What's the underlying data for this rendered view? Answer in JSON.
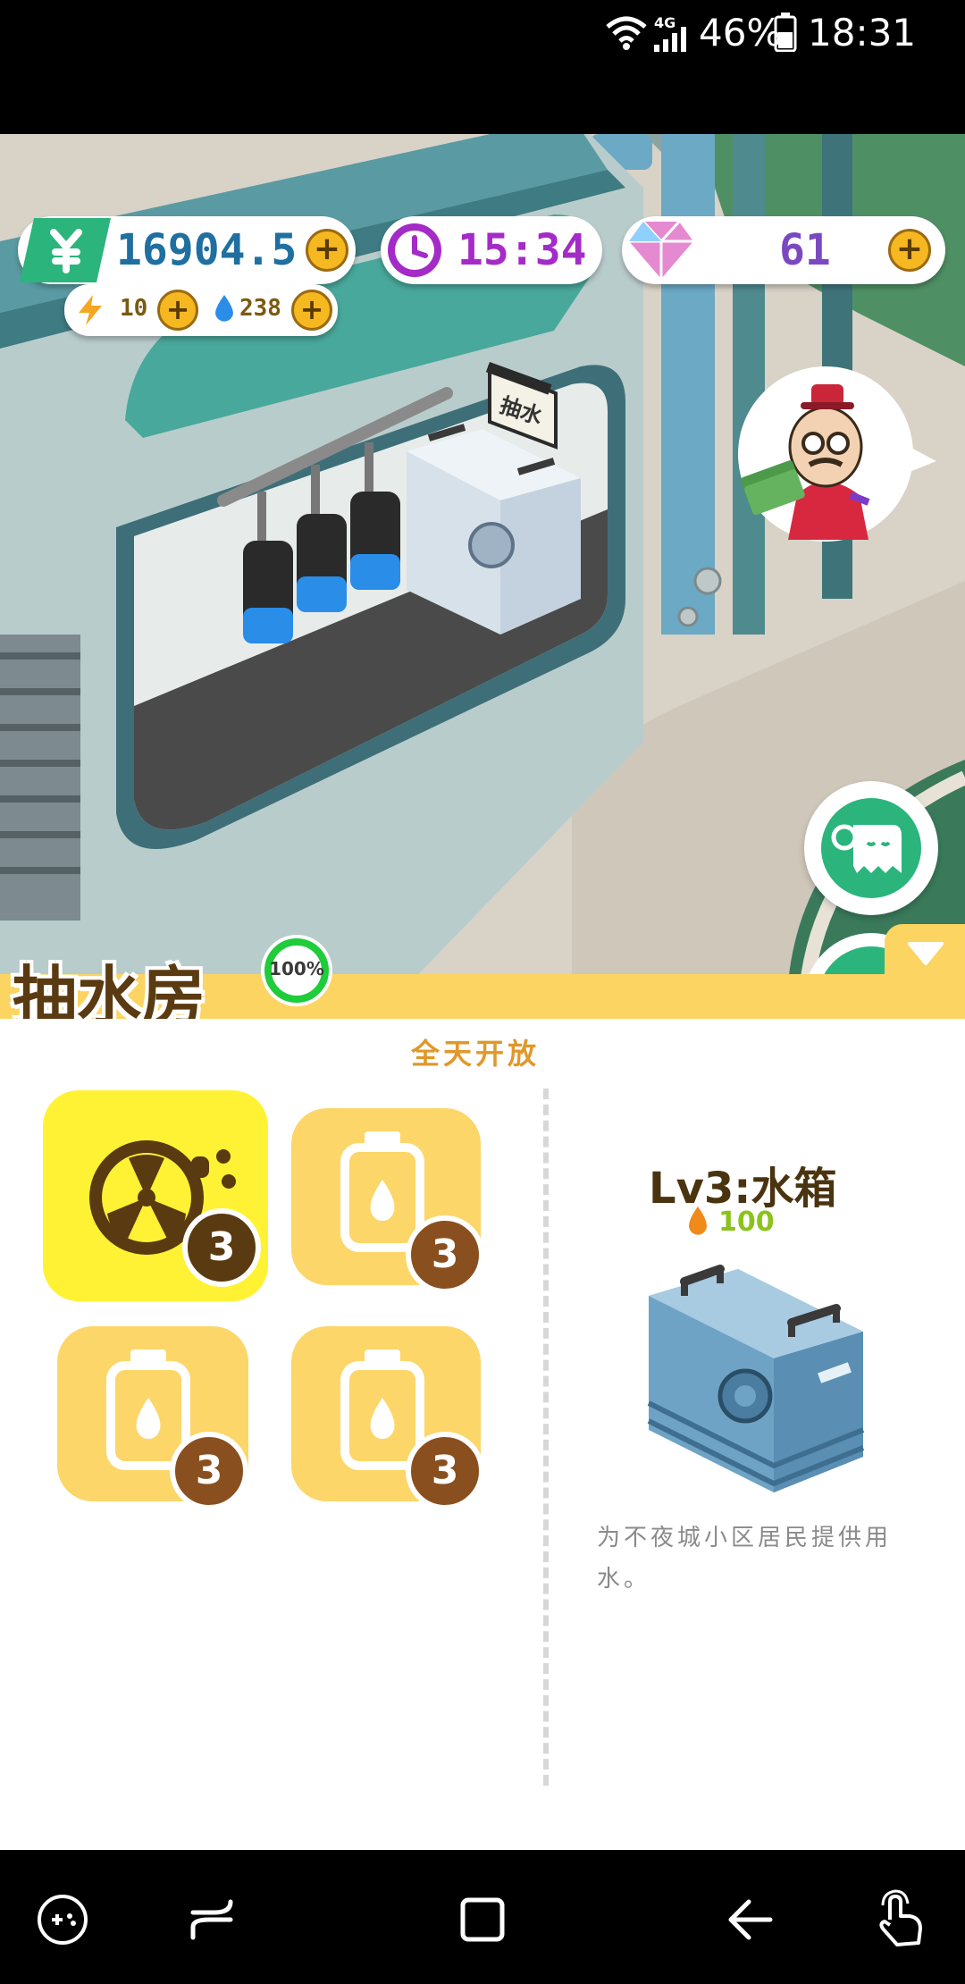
{
  "status_bar": {
    "network": "4G",
    "battery": "46%",
    "time": "18:31"
  },
  "hud": {
    "money": "16904.5",
    "energy": "10",
    "water": "238",
    "timer": "15:34",
    "gems": "61"
  },
  "scene": {
    "sign_label": "抽水"
  },
  "building": {
    "name": "抽水房",
    "progress_text": "100%",
    "progress": 1.0,
    "hours": "全天开放"
  },
  "slots": [
    {
      "icon": "fan-icon",
      "count": "3",
      "selected": true
    },
    {
      "icon": "water-bottle-icon",
      "count": "3",
      "selected": false
    },
    {
      "icon": "water-bottle-icon",
      "count": "3",
      "selected": false
    },
    {
      "icon": "water-bottle-icon",
      "count": "3",
      "selected": false
    }
  ],
  "detail": {
    "title": "Lv3:水箱",
    "cost": "100",
    "description": "为不夜城小区居民提供用水。"
  },
  "colors": {
    "panel_yellow": "#fcd461",
    "selected_tile": "#fff234",
    "tile": "#fcd668",
    "badge": "#8a4f1f",
    "accent_green": "#2bb57c",
    "timer_purple": "#a42bc8"
  }
}
